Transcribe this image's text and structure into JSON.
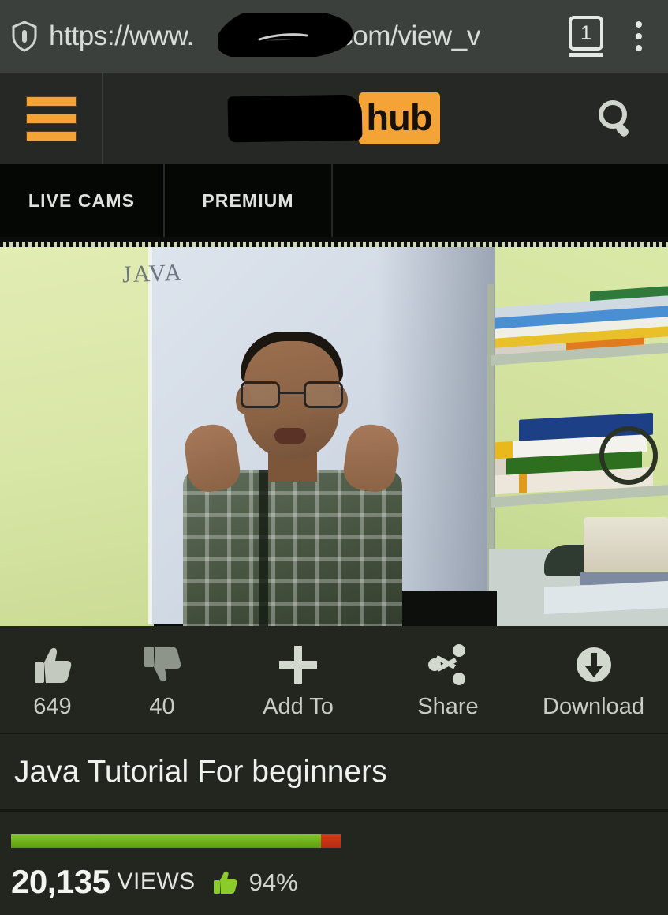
{
  "browser": {
    "security_icon": "shield-icon",
    "url_scheme": "https://www.",
    "url_redacted_placeholder": "",
    "url_tail": "ub.com/view_v",
    "tab_count": "1",
    "menu_icon": "overflow-menu-icon"
  },
  "site_header": {
    "menu_icon": "hamburger-icon",
    "logo_redacted": "",
    "logo_suffix": "hub",
    "logo_accent_color": "#f4a436",
    "search_icon": "search-icon"
  },
  "nav": {
    "tabs": [
      {
        "label": "LIVE CAMS"
      },
      {
        "label": "PREMIUM"
      },
      {
        "label": ""
      }
    ]
  },
  "video": {
    "whiteboard_text": "JAVA",
    "scene_description": "man presenting in front of whiteboard"
  },
  "actions": [
    {
      "icon": "thumbs-up-icon",
      "label": "649"
    },
    {
      "icon": "thumbs-down-icon",
      "label": "40"
    },
    {
      "icon": "plus-icon",
      "label": "Add To"
    },
    {
      "icon": "share-icon",
      "label": "Share"
    },
    {
      "icon": "download-icon",
      "label": "Download"
    }
  ],
  "video_info": {
    "title": "Java Tutorial For beginners",
    "views_count": "20,135",
    "views_label": "VIEWS",
    "rating_percent": "94%",
    "rating_icon": "thumbs-up-icon",
    "rating_positive_pct": 94,
    "rating_negative_pct": 6,
    "rating_positive_color": "#7ec020",
    "rating_negative_color": "#c9330f"
  }
}
